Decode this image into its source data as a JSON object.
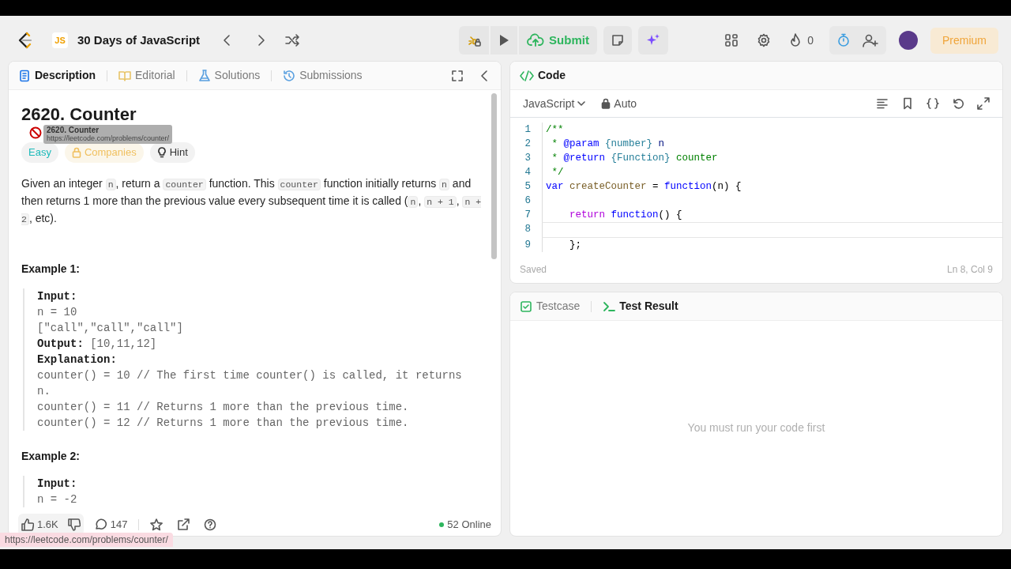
{
  "nav": {
    "badge": "JS",
    "title": "30 Days of JavaScript",
    "submit": "Submit",
    "streak": "0",
    "premium": "Premium"
  },
  "description_panel": {
    "tabs": [
      {
        "label": "Description",
        "selected": true,
        "kind": "doc"
      },
      {
        "label": "Editorial",
        "selected": false,
        "kind": "book"
      },
      {
        "label": "Solutions",
        "selected": false,
        "kind": "flask"
      },
      {
        "label": "Submissions",
        "selected": false,
        "kind": "history"
      }
    ],
    "title": "2620. Counter",
    "tooltip": {
      "title": "2620. Counter",
      "url": "https://leetcode.com/problems/counter/"
    },
    "tags": [
      {
        "label": "Easy",
        "kind": "difficulty"
      },
      {
        "label": "Companies",
        "kind": "companies"
      },
      {
        "label": "Hint",
        "kind": "hint"
      }
    ],
    "description": [
      {
        "text": "Given an integer ",
        "kind": "text"
      },
      {
        "text": "n",
        "kind": "code"
      },
      {
        "text": ", return a ",
        "kind": "text"
      },
      {
        "text": "counter",
        "kind": "code"
      },
      {
        "text": " function. This ",
        "kind": "text"
      },
      {
        "text": "counter",
        "kind": "code"
      },
      {
        "text": " function initially returns ",
        "kind": "text"
      },
      {
        "text": "n",
        "kind": "code"
      },
      {
        "text": " and then returns 1 more than the previous value every subsequent time it is called (",
        "kind": "text"
      },
      {
        "text": "n",
        "kind": "code"
      },
      {
        "text": ", ",
        "kind": "text"
      },
      {
        "text": "n + 1",
        "kind": "code"
      },
      {
        "text": ", ",
        "kind": "text"
      },
      {
        "text": "n + 2",
        "kind": "code"
      },
      {
        "text": ", etc).",
        "kind": "text"
      }
    ],
    "examples": [
      {
        "heading": "Example 1:",
        "lines": [
          {
            "label": "Input:"
          },
          {
            "text": "n = 10"
          },
          {
            "text": "[\"call\",\"call\",\"call\"]"
          },
          {
            "label": "Output:",
            "text": "[10,11,12]"
          },
          {
            "label": "Explanation:"
          },
          {
            "text": "counter() = 10 // The first time counter() is called, it returns n."
          },
          {
            "text": "counter() = 11 // Returns 1 more than the previous time."
          },
          {
            "text": "counter() = 12 // Returns 1 more than the previous time."
          }
        ]
      },
      {
        "heading": "Example 2:",
        "lines": [
          {
            "label": "Input:"
          },
          {
            "text": "n = -2"
          }
        ]
      }
    ],
    "footer": {
      "likes": "1.6K",
      "comments": "147",
      "online": "52 Online"
    }
  },
  "status_url": "https://leetcode.com/problems/counter/",
  "code_panel": {
    "title": "Code",
    "language": "JavaScript",
    "mode": "Auto",
    "saved": "Saved",
    "cursor": "Ln 8, Col 9",
    "lines": [
      {
        "number": "1",
        "current": false,
        "tokens": [
          {
            "text": "/**",
            "kind": "comment"
          }
        ]
      },
      {
        "number": "2",
        "current": false,
        "tokens": [
          {
            "text": " * ",
            "kind": "comment"
          },
          {
            "text": "@param",
            "kind": "tag"
          },
          {
            "text": " {number}",
            "kind": "type"
          },
          {
            "text": " n",
            "kind": "param"
          }
        ]
      },
      {
        "number": "3",
        "current": false,
        "tokens": [
          {
            "text": " * ",
            "kind": "comment"
          },
          {
            "text": "@return",
            "kind": "tag"
          },
          {
            "text": " {Function}",
            "kind": "type"
          },
          {
            "text": " counter",
            "kind": "comment"
          }
        ]
      },
      {
        "number": "4",
        "current": false,
        "tokens": [
          {
            "text": " */",
            "kind": "comment"
          }
        ]
      },
      {
        "number": "5",
        "current": false,
        "tokens": [
          {
            "text": "var",
            "kind": "keyword"
          },
          {
            "text": " createCounter",
            "kind": "fn"
          },
          {
            "text": " = ",
            "kind": "plain"
          },
          {
            "text": "function",
            "kind": "keyword"
          },
          {
            "text": "(n) {",
            "kind": "plain"
          }
        ]
      },
      {
        "number": "6",
        "current": false
      },
      {
        "number": "7",
        "current": false,
        "tokens": [
          {
            "text": "    return",
            "kind": "control"
          },
          {
            "text": " function",
            "kind": "keyword"
          },
          {
            "text": "() {",
            "kind": "plain"
          }
        ]
      },
      {
        "number": "8",
        "current": true
      },
      {
        "number": "9",
        "current": false,
        "tokens": [
          {
            "text": "    };",
            "kind": "plain"
          }
        ]
      }
    ]
  },
  "test_panel": {
    "tabs": [
      {
        "label": "Testcase",
        "selected": false,
        "kind": "check"
      },
      {
        "label": "Test Result",
        "selected": true,
        "kind": "terminal"
      }
    ],
    "message": "You must run your code first"
  }
}
